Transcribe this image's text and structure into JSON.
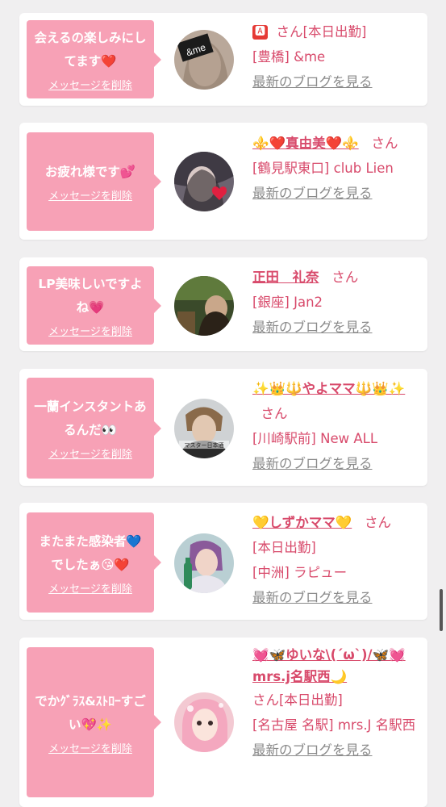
{
  "delete_label": "メッセージを削除",
  "blog_label": "最新のブログを見る",
  "colors": {
    "accent": "#f7a1b6",
    "name": "#d84a6b",
    "link_gray": "#8a8a8a"
  },
  "cards": [
    {
      "message": "会えるの楽しみにしてます❤️",
      "name_prefix": "🅰",
      "name": "",
      "san": "さん",
      "status": "[本日出勤]",
      "location": "[豊橋] &me",
      "avatar_text": "&me"
    },
    {
      "message": "お疲れ様です💕",
      "name": "⚜️❤️真由美❤️⚜️",
      "san": "さん",
      "status": "",
      "location": "[鶴見駅東口] club Lien"
    },
    {
      "message": "LP美味しいですよね💗",
      "name": "正田　礼奈",
      "san": "さん",
      "status": "",
      "location": "[銀座] Jan2"
    },
    {
      "message": "一蘭インスタントあるんだ👀",
      "name": "✨👑🔱やよママ🔱👑✨",
      "san": "さん",
      "status": "",
      "location": "[川崎駅前] New ALL",
      "avatar_text": "マスター日本酒"
    },
    {
      "message": "またまた感染者💙でしたぁ😘❤️",
      "name": "💛しずかママ💛",
      "san": "さん",
      "status": "[本日出勤]",
      "location": "[中洲] ラピュー"
    },
    {
      "message": "でかｸﾞﾗｽ&ｽﾄﾛｰすごい💖✨",
      "name": "💓🦋ゆいな\\(´ω`)/🦋💓mrs.j名駅西🌙",
      "san": "さん",
      "status": "[本日出勤]",
      "location": "[名古屋 名駅] mrs.J 名駅西"
    }
  ]
}
